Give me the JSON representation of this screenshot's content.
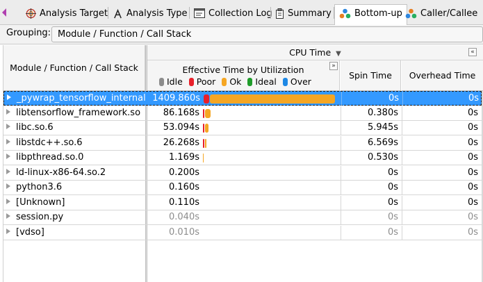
{
  "tabs": [
    {
      "label": "Analysis Target",
      "icon": "target-icon",
      "active": false
    },
    {
      "label": "Analysis Type",
      "icon": "lambda-icon",
      "active": false
    },
    {
      "label": "Collection Log",
      "icon": "terminal-log-icon",
      "active": false
    },
    {
      "label": "Summary",
      "icon": "clipboard-icon",
      "active": false
    },
    {
      "label": "Bottom-up",
      "icon": "bottom-up-icon",
      "active": true
    },
    {
      "label": "Caller/Callee",
      "icon": "caller-callee-icon",
      "active": false
    }
  ],
  "grouping": {
    "label": "Grouping:",
    "value": "Module / Function / Call Stack"
  },
  "grid": {
    "col_name": "Module / Function / Call Stack",
    "col_group": "CPU Time",
    "col_group_sort": "▼",
    "col_eff": "Effective Time by Utilization",
    "col_spin": "Spin Time",
    "col_ovh": "Overhead Time",
    "expand_btn": "»",
    "collapse_btn": "«",
    "legend": [
      {
        "label": "Idle",
        "color": "#8c8c8c"
      },
      {
        "label": "Poor",
        "color": "#e8202a"
      },
      {
        "label": "Ok",
        "color": "#f5a623"
      },
      {
        "label": "Ideal",
        "color": "#1f9c2a"
      },
      {
        "label": "Over",
        "color": "#1e88e5"
      }
    ]
  },
  "rows": [
    {
      "name": "_pywrap_tensorflow_internal.",
      "eff": "1409.860s",
      "spin": "0s",
      "ovh": "0s",
      "selected": true,
      "dim": false,
      "poor_frac": 0.045,
      "ok_frac": 0.955
    },
    {
      "name": "libtensorflow_framework.so",
      "eff": "86.168s",
      "spin": "0.380s",
      "ovh": "0s",
      "selected": false,
      "dim": false,
      "poor_frac": 0.011,
      "ok_frac": 0.043
    },
    {
      "name": "libc.so.6",
      "eff": "53.094s",
      "spin": "5.945s",
      "ovh": "0s",
      "selected": false,
      "dim": false,
      "poor_frac": 0.011,
      "ok_frac": 0.027
    },
    {
      "name": "libstdc++.so.6",
      "eff": "26.268s",
      "spin": "6.569s",
      "ovh": "0s",
      "selected": false,
      "dim": false,
      "poor_frac": 0.011,
      "ok_frac": 0.011
    },
    {
      "name": "libpthread.so.0",
      "eff": "1.169s",
      "spin": "0.530s",
      "ovh": "0s",
      "selected": false,
      "dim": false,
      "poor_frac": 0.0,
      "ok_frac": 0.006
    },
    {
      "name": "ld-linux-x86-64.so.2",
      "eff": "0.200s",
      "spin": "0s",
      "ovh": "0s",
      "selected": false,
      "dim": false,
      "poor_frac": 0,
      "ok_frac": 0
    },
    {
      "name": "python3.6",
      "eff": "0.160s",
      "spin": "0s",
      "ovh": "0s",
      "selected": false,
      "dim": false,
      "poor_frac": 0,
      "ok_frac": 0
    },
    {
      "name": "[Unknown]",
      "eff": "0.110s",
      "spin": "0s",
      "ovh": "0s",
      "selected": false,
      "dim": false,
      "poor_frac": 0,
      "ok_frac": 0
    },
    {
      "name": "session.py",
      "eff": "0.040s",
      "spin": "0s",
      "ovh": "0s",
      "selected": false,
      "dim": true,
      "poor_frac": 0,
      "ok_frac": 0
    },
    {
      "name": "[vdso]",
      "eff": "0.010s",
      "spin": "0s",
      "ovh": "0s",
      "selected": false,
      "dim": true,
      "poor_frac": 0,
      "ok_frac": 0
    }
  ]
}
